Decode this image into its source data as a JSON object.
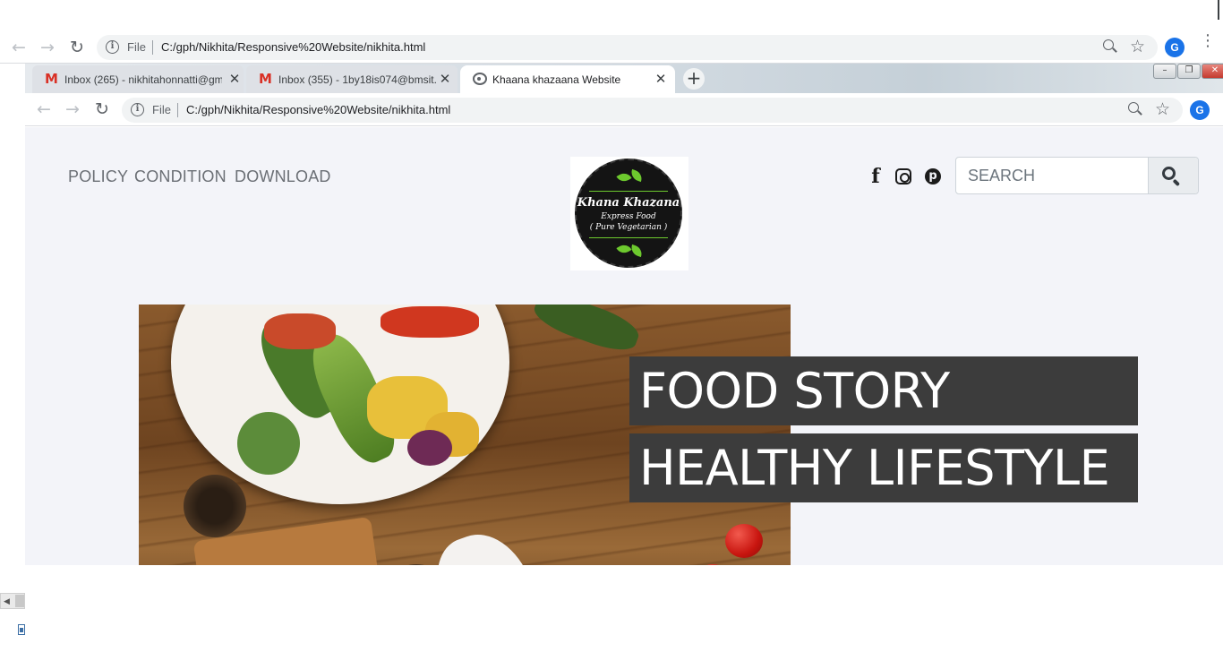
{
  "outer_browser": {
    "omnibox": {
      "scheme_label": "File",
      "url": "C:/gph/Nikhita/Responsive%20Website/nikhita.html"
    },
    "avatar_letter": "G"
  },
  "inner_browser": {
    "tabs": [
      {
        "title": "Inbox (265) - nikhitahonnatti@gm",
        "icon": "gmail-icon",
        "active": false
      },
      {
        "title": "Inbox (355) - 1by18is074@bmsit.",
        "icon": "gmail-icon",
        "active": false
      },
      {
        "title": "Khaana khazaana Website",
        "icon": "globe-icon",
        "active": true
      }
    ],
    "omnibox": {
      "scheme_label": "File",
      "url": "C:/gph/Nikhita/Responsive%20Website/nikhita.html"
    },
    "avatar_letter": "G"
  },
  "site": {
    "nav": [
      "POLICY",
      "CONDITION",
      "DOWNLOAD"
    ],
    "logo": {
      "title": "Khana Khazana",
      "line1": "Express Food",
      "line2": "( Pure Vegetarian )"
    },
    "social": [
      "facebook-icon",
      "instagram-icon",
      "pinterest-icon"
    ],
    "search": {
      "placeholder": "SEARCH",
      "value": ""
    },
    "hero": {
      "headline_1": "FOOD STORY",
      "headline_2": "HEALTHY LIFESTYLE"
    }
  },
  "colors": {
    "page_background": "#f3f4f9",
    "nav_text": "#6b6f75",
    "headline_background": "#3c3c3c",
    "logo_accent": "#6dc92e",
    "avatar": "#1a73e8"
  }
}
